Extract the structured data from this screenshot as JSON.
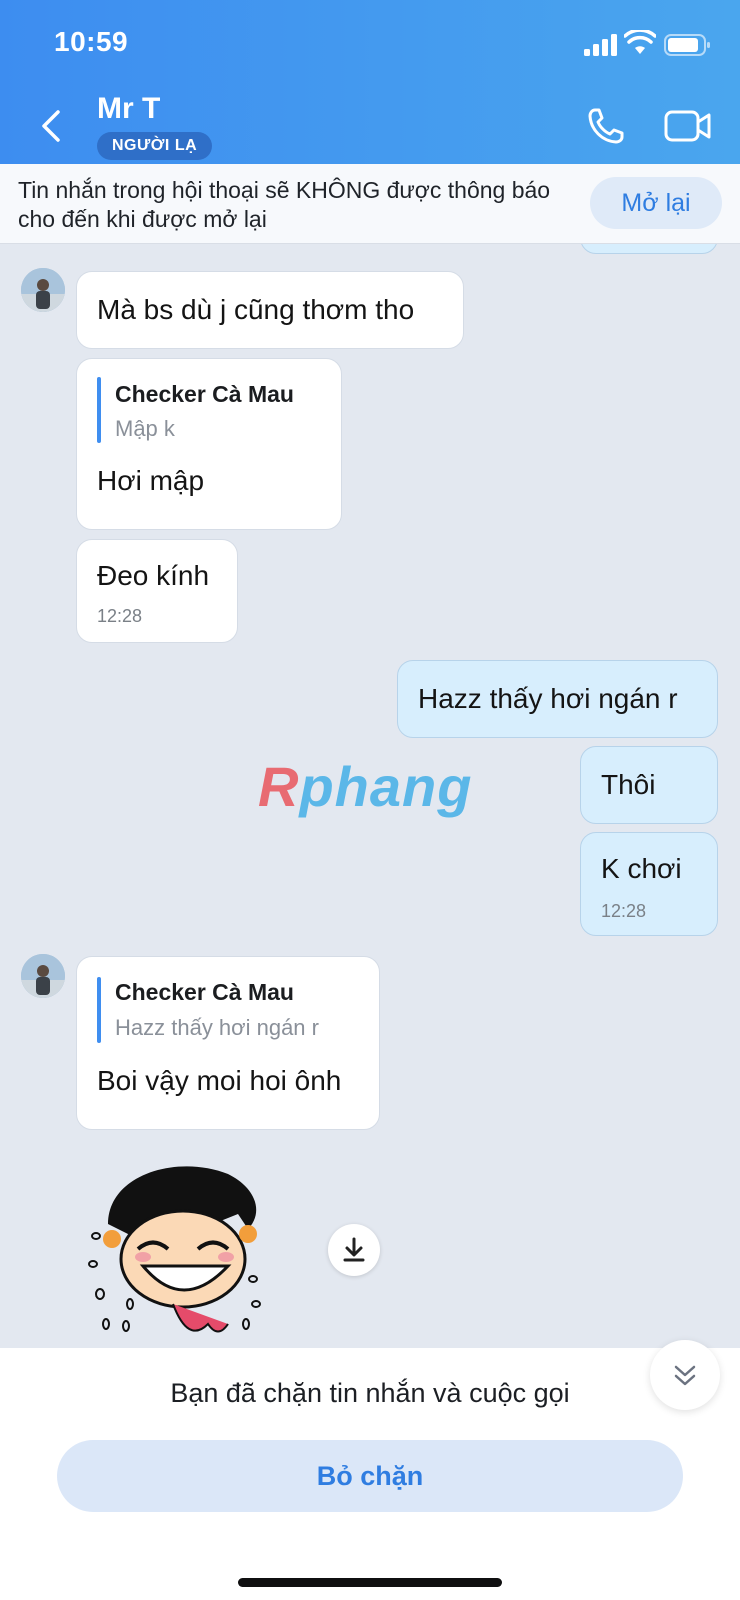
{
  "status_bar": {
    "time": "10:59"
  },
  "header": {
    "title": "Mr T",
    "badge": "NGƯỜI LẠ"
  },
  "notice": {
    "text": "Tin nhắn trong hội thoại sẽ KHÔNG được thông báo cho đến khi được mở lại",
    "button": "Mở lại"
  },
  "messages": [
    {
      "side": "them",
      "text": "Mà bs dù j cũng thơm tho"
    },
    {
      "side": "them",
      "quote_name": "Checker Cà Mau",
      "quote_text": "Mập k",
      "text": "Hơi mập"
    },
    {
      "side": "them",
      "text": "Đeo kính",
      "time": "12:28"
    },
    {
      "side": "me",
      "text": "Hazz thấy hơi ngán r"
    },
    {
      "side": "me",
      "text": "Thôi"
    },
    {
      "side": "me",
      "text": "K chơi",
      "time": "12:28"
    },
    {
      "side": "them",
      "quote_name": "Checker Cà Mau",
      "quote_text": "Hazz thấy hơi ngán r",
      "text": "Boi vậy moi hoi ônh"
    }
  ],
  "watermark": {
    "first": "R",
    "rest": "phang"
  },
  "bottom": {
    "blocked_text": "Bạn đã chặn tin nhắn và cuộc gọi",
    "unblock_button": "Bỏ chặn"
  },
  "colors": {
    "header_gradient_start": "#3d8df0",
    "header_gradient_end": "#4aa6ee",
    "accent": "#2f7de1",
    "my_bubble": "#d7eefd",
    "chat_bg": "#e3e8f0"
  },
  "icons": [
    "back-icon",
    "phone-icon",
    "video-call-icon",
    "download-icon",
    "chevron-double-down-icon",
    "signal-icon",
    "wifi-icon",
    "battery-icon"
  ]
}
